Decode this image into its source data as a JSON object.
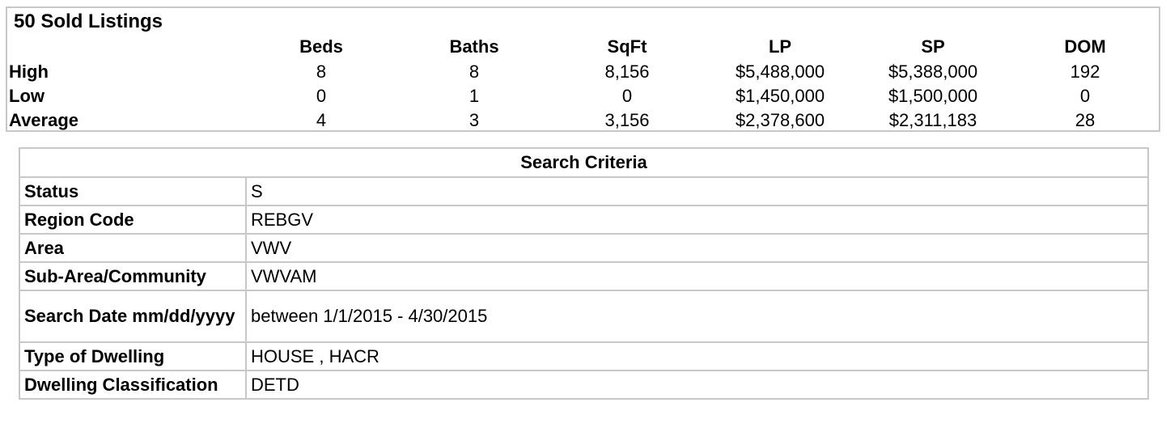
{
  "summary": {
    "title": "50 Sold Listings",
    "columns": [
      "Beds",
      "Baths",
      "SqFt",
      "LP",
      "SP",
      "DOM"
    ],
    "rows": [
      {
        "label": "High",
        "values": [
          "8",
          "8",
          "8,156",
          "$5,488,000",
          "$5,388,000",
          "192"
        ]
      },
      {
        "label": "Low",
        "values": [
          "0",
          "1",
          "0",
          "$1,450,000",
          "$1,500,000",
          "0"
        ]
      },
      {
        "label": "Average",
        "values": [
          "4",
          "3",
          "3,156",
          "$2,378,600",
          "$2,311,183",
          "28"
        ]
      }
    ]
  },
  "criteria": {
    "heading": "Search Criteria",
    "rows": [
      {
        "key": "Status",
        "value": "S"
      },
      {
        "key": "Region Code",
        "value": "REBGV"
      },
      {
        "key": "Area",
        "value": "VWV"
      },
      {
        "key": "Sub-Area/Community",
        "value": "VWVAM"
      },
      {
        "key": "Search Date mm/dd/yyyy",
        "value": "between 1/1/2015 - 4/30/2015"
      },
      {
        "key": "Type of Dwelling",
        "value": "HOUSE , HACR"
      },
      {
        "key": "Dwelling Classification",
        "value": "DETD"
      }
    ]
  }
}
